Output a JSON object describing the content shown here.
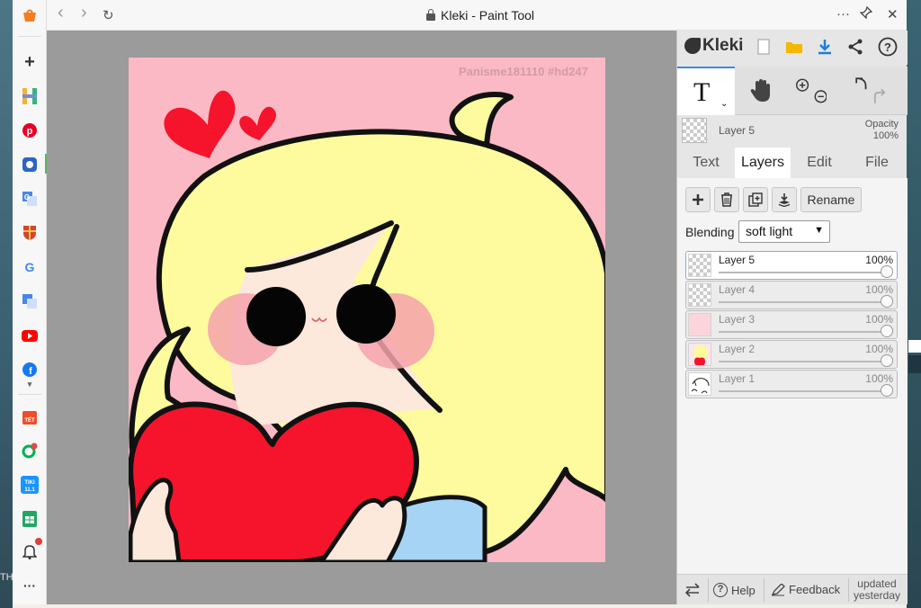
{
  "browser": {
    "title": "Kleki - Paint Tool",
    "nav_back": "‹",
    "nav_forward": "›",
    "refresh": "↻",
    "more": "···",
    "pin": "📌",
    "close": "✕"
  },
  "desktop": {
    "left_text": "TH"
  },
  "edge_sidebar": {
    "add": "+",
    "more": "···",
    "expand": "▾"
  },
  "canvas": {
    "watermark": "Panisme181110 #hd247"
  },
  "kleki": {
    "logo": "Kleki",
    "tool_letter": "T",
    "layer_name": "Layer 5",
    "opacity_label": "Opacity",
    "opacity_value": "100%",
    "tabs": [
      "Text",
      "Layers",
      "Edit",
      "File"
    ],
    "active_tab": "Layers",
    "rename_label": "Rename",
    "blending_label": "Blending",
    "blending_value": "soft light",
    "layers": [
      {
        "name": "Layer 5",
        "opacity": "100%",
        "selected": true
      },
      {
        "name": "Layer 4",
        "opacity": "100%",
        "selected": false
      },
      {
        "name": "Layer 3",
        "opacity": "100%",
        "selected": false
      },
      {
        "name": "Layer 2",
        "opacity": "100%",
        "selected": false
      },
      {
        "name": "Layer 1",
        "opacity": "100%",
        "selected": false
      }
    ],
    "footer": {
      "help": "Help",
      "feedback": "Feedback",
      "updated_line1": "updated",
      "updated_line2": "yesterday"
    }
  },
  "colors": {
    "canvas_bg": "#fbb9c5",
    "hair": "#fdfb9d",
    "heart": "#f5142c",
    "accent": "#3b8be0"
  }
}
